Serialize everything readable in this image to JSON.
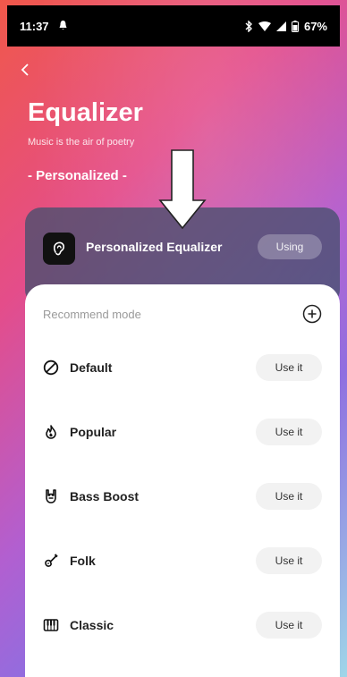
{
  "status": {
    "time": "11:37",
    "battery": "67%"
  },
  "header": {
    "title": "Equalizer",
    "subtitle": "Music is the air of poetry",
    "section": "- Personalized -"
  },
  "active": {
    "name": "Personalized Equalizer",
    "status": "Using"
  },
  "sheet": {
    "title": "Recommend mode",
    "modes": [
      {
        "label": "Default",
        "icon": "no-sign-icon",
        "action": "Use it"
      },
      {
        "label": "Popular",
        "icon": "flame-icon",
        "action": "Use it"
      },
      {
        "label": "Bass Boost",
        "icon": "rock-hand-icon",
        "action": "Use it"
      },
      {
        "label": "Folk",
        "icon": "guitar-icon",
        "action": "Use it"
      },
      {
        "label": "Classic",
        "icon": "piano-icon",
        "action": "Use it"
      }
    ]
  },
  "colors": {
    "bg_start": "#f0584a",
    "bg_mid": "#b25fd0",
    "bg_end": "#9fd6e8",
    "card": "#46506e"
  }
}
